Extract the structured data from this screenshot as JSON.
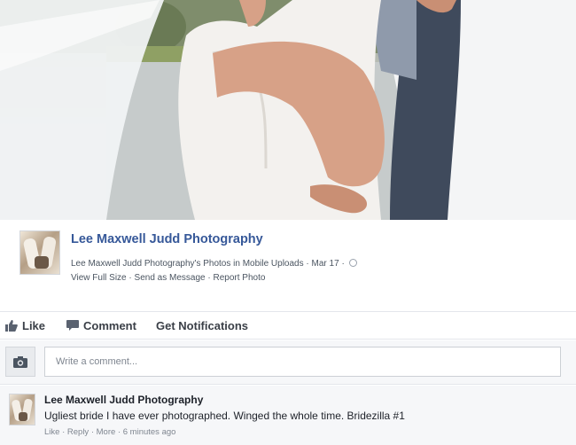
{
  "post": {
    "author": "Lee Maxwell Judd Photography",
    "album_line": "Lee Maxwell Judd Photography's Photos in Mobile Uploads",
    "date": "Mar 17",
    "links": {
      "view_full_size": "View Full Size",
      "send_as_message": "Send as Message",
      "report_photo": "Report Photo"
    },
    "separator": "·"
  },
  "actions": {
    "like": "Like",
    "comment": "Comment",
    "get_notifications": "Get Notifications"
  },
  "composer": {
    "placeholder": "Write a comment..."
  },
  "comment": {
    "author": "Lee Maxwell Judd Photography",
    "text": "Ugliest bride I have ever photographed. Winged the whole time. Bridezilla #1",
    "like": "Like",
    "reply": "Reply",
    "more": "More",
    "time": "6 minutes ago",
    "separator": "·"
  },
  "colors": {
    "link_blue": "#365899",
    "muted_text": "#7f8690",
    "composer_bg": "#f6f7f9"
  },
  "icons": {
    "like": "thumbs-up-icon",
    "comment": "speech-bubble-icon",
    "camera": "camera-icon",
    "privacy": "globe-icon"
  }
}
